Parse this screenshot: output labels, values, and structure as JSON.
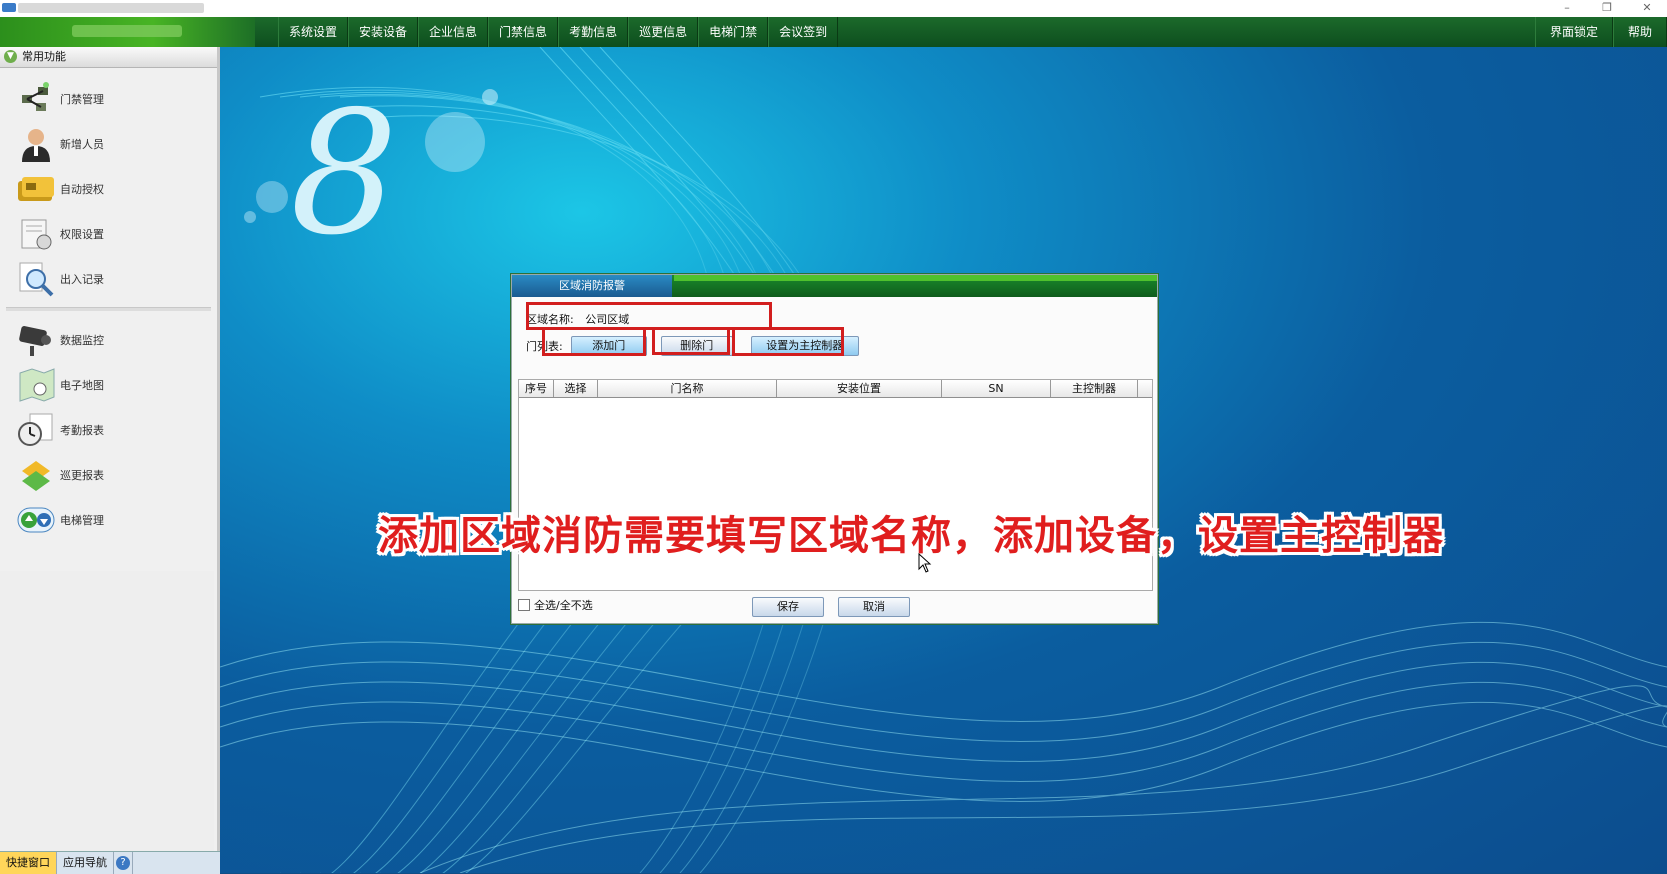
{
  "window": {
    "controls": [
      "–",
      "❐",
      "✕"
    ]
  },
  "menubar": {
    "items": [
      "系统设置",
      "安装设备",
      "企业信息",
      "门禁信息",
      "考勤信息",
      "巡更信息",
      "电梯门禁",
      "会议签到"
    ],
    "right": [
      "界面锁定",
      "帮助"
    ]
  },
  "sidebar": {
    "header": "常用功能",
    "group1": [
      {
        "label": "门禁管理",
        "icon": "door-control-icon"
      },
      {
        "label": "新增人员",
        "icon": "person-icon"
      },
      {
        "label": "自动授权",
        "icon": "card-icon"
      },
      {
        "label": "权限设置",
        "icon": "permission-icon"
      },
      {
        "label": "出入记录",
        "icon": "magnifier-icon"
      }
    ],
    "group2": [
      {
        "label": "数据监控",
        "icon": "camera-icon"
      },
      {
        "label": "电子地图",
        "icon": "map-icon"
      },
      {
        "label": "考勤报表",
        "icon": "clock-icon"
      },
      {
        "label": "巡更报表",
        "icon": "patrol-icon"
      },
      {
        "label": "电梯管理",
        "icon": "elevator-icon"
      }
    ]
  },
  "bottombar": {
    "tabs": [
      "快捷窗口",
      "应用导航"
    ],
    "help": "?"
  },
  "dialog": {
    "title": "区域消防报警",
    "area_name_label": "区域名称:",
    "area_name_value": "公司区域",
    "door_list_label": "门列表:",
    "add_door": "添加门",
    "delete_door": "删除门",
    "set_master": "设置为主控制器",
    "columns": [
      "序号",
      "选择",
      "门名称",
      "安装位置",
      "SN",
      "主控制器"
    ],
    "select_all": "全选/全不选",
    "save": "保存",
    "cancel": "取消"
  },
  "logo_digit": "8",
  "caption": "添加区域消防需要填写区域名称，添加设备，设置主控制器"
}
